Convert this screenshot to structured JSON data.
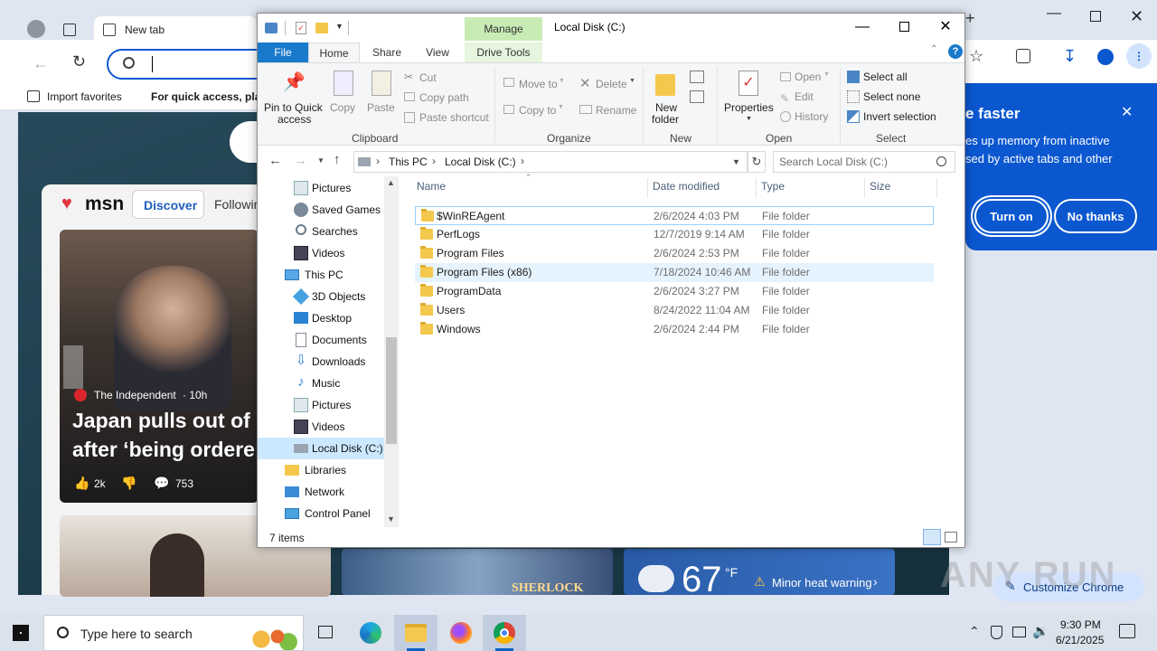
{
  "chrome": {
    "tab_title": "New tab",
    "bookmarks": {
      "import_favorites": "Import favorites",
      "quick_access": "For quick access, plac"
    },
    "msn": {
      "logo": "msn",
      "tab_discover": "Discover",
      "tab_following": "Followin",
      "source": "The Independent",
      "source_time": "· 10h",
      "headline_line1": "Japan pulls out of",
      "headline_line2": "after ‘being ordere",
      "likes": "2k",
      "comments": "753"
    },
    "weather": {
      "temp": "67",
      "unit": "°F",
      "warning": "Minor heat warning"
    },
    "game_card": "SHERLOCK",
    "perf_popup": {
      "title": "e faster",
      "body_line1": "es up memory from inactive",
      "body_line2": "sed by active tabs and other",
      "turn_on": "Turn on",
      "no_thanks": "No thanks"
    },
    "customize_chrome": "Customize Chrome",
    "watermark": "ANY RUN"
  },
  "explorer": {
    "title": "Local Disk (C:)",
    "manage_label": "Manage",
    "tabs": {
      "file": "File",
      "home": "Home",
      "share": "Share",
      "view": "View",
      "drive_tools": "Drive Tools"
    },
    "ribbon": {
      "clipboard": {
        "label": "Clipboard",
        "pin_line1": "Pin to Quick",
        "pin_line2": "access",
        "copy": "Copy",
        "paste": "Paste",
        "cut": "Cut",
        "copy_path": "Copy path",
        "paste_shortcut": "Paste shortcut"
      },
      "organize": {
        "label": "Organize",
        "move_to": "Move to",
        "copy_to": "Copy to",
        "delete": "Delete",
        "rename": "Rename"
      },
      "new": {
        "label": "New",
        "new_folder_line1": "New",
        "new_folder_line2": "folder"
      },
      "open": {
        "label": "Open",
        "properties": "Properties",
        "open": "Open",
        "edit": "Edit",
        "history": "History"
      },
      "select": {
        "label": "Select",
        "select_all": "Select all",
        "select_none": "Select none",
        "invert": "Invert selection"
      }
    },
    "address": {
      "this_pc": "This PC",
      "local_disk": "Local Disk (C:)",
      "search_placeholder": "Search Local Disk (C:)"
    },
    "nav": [
      {
        "label": "Pictures",
        "icon": "pictures-icon"
      },
      {
        "label": "Saved Games",
        "icon": "saved-games-icon"
      },
      {
        "label": "Searches",
        "icon": "searches-icon"
      },
      {
        "label": "Videos",
        "icon": "videos-icon"
      },
      {
        "label": "This PC",
        "icon": "this-pc-icon"
      },
      {
        "label": "3D Objects",
        "icon": "3d-objects-icon"
      },
      {
        "label": "Desktop",
        "icon": "desktop-icon"
      },
      {
        "label": "Documents",
        "icon": "documents-icon"
      },
      {
        "label": "Downloads",
        "icon": "downloads-icon"
      },
      {
        "label": "Music",
        "icon": "music-icon"
      },
      {
        "label": "Pictures",
        "icon": "pictures-icon"
      },
      {
        "label": "Videos",
        "icon": "videos-icon"
      },
      {
        "label": "Local Disk (C:)",
        "icon": "local-disk-icon"
      },
      {
        "label": "Libraries",
        "icon": "libraries-icon"
      },
      {
        "label": "Network",
        "icon": "network-icon"
      },
      {
        "label": "Control Panel",
        "icon": "control-panel-icon"
      }
    ],
    "columns": {
      "name": "Name",
      "date_modified": "Date modified",
      "type": "Type",
      "size": "Size"
    },
    "files": [
      {
        "name": "$WinREAgent",
        "date": "2/6/2024 4:03 PM",
        "type": "File folder"
      },
      {
        "name": "PerfLogs",
        "date": "12/7/2019 9:14 AM",
        "type": "File folder"
      },
      {
        "name": "Program Files",
        "date": "2/6/2024 2:53 PM",
        "type": "File folder"
      },
      {
        "name": "Program Files (x86)",
        "date": "7/18/2024 10:46 AM",
        "type": "File folder"
      },
      {
        "name": "ProgramData",
        "date": "2/6/2024 3:27 PM",
        "type": "File folder"
      },
      {
        "name": "Users",
        "date": "8/24/2022 11:04 AM",
        "type": "File folder"
      },
      {
        "name": "Windows",
        "date": "2/6/2024 2:44 PM",
        "type": "File folder"
      }
    ],
    "status": "7 items"
  },
  "taskbar": {
    "search_placeholder": "Type here to search",
    "time": "9:30 PM",
    "date": "6/21/2025"
  }
}
